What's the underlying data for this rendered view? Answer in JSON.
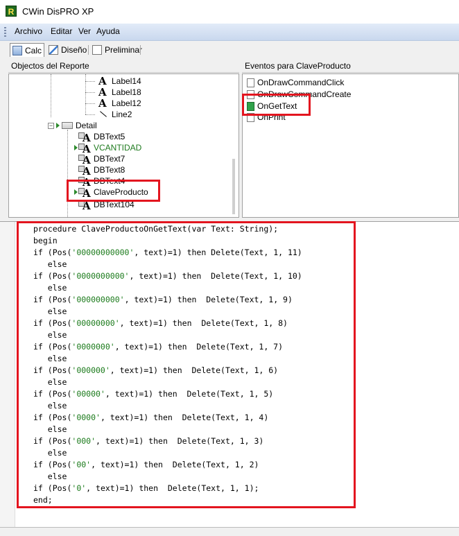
{
  "window": {
    "title": "CWin DisPRO XP",
    "icon_letter": "R"
  },
  "menu": [
    "Archivo",
    "Editar",
    "Ver",
    "Ayuda"
  ],
  "tabs": [
    {
      "label": "Calc",
      "active": true,
      "icon": "calculator-icon"
    },
    {
      "label": "Diseño",
      "active": false,
      "icon": "design-icon"
    },
    {
      "label": "Preliminar",
      "active": false,
      "icon": "preview-icon"
    }
  ],
  "objects_panel": {
    "header": "Objectos del Reporte",
    "nodes": {
      "label14": "Label14",
      "label18": "Label18",
      "label12": "Label12",
      "line2": "Line2",
      "detail": "Detail",
      "dbtext5": "DBText5",
      "vcantidad": "VCANTIDAD",
      "dbtext7": "DBText7",
      "dbtext8": "DBText8",
      "dbtext4": "DBText4",
      "claveproducto": "ClaveProducto",
      "dbtext104": "DBText104"
    }
  },
  "events_panel": {
    "header": "Eventos para ClaveProducto",
    "events": [
      "OnDrawCommandClick",
      "OnDrawCommandCreate",
      "OnGetText",
      "OnPrint"
    ],
    "selected": "OnGetText"
  },
  "code": [
    "procedure ClaveProductoOnGetText(var Text: String);",
    "begin",
    "if (Pos('00000000000', text)=1) then Delete(Text, 1, 11)",
    "   else",
    "if (Pos('0000000000', text)=1) then  Delete(Text, 1, 10)",
    "   else",
    "if (Pos('000000000', text)=1) then  Delete(Text, 1, 9)",
    "   else",
    "if (Pos('00000000', text)=1) then  Delete(Text, 1, 8)",
    "   else",
    "if (Pos('0000000', text)=1) then  Delete(Text, 1, 7)",
    "   else",
    "if (Pos('000000', text)=1) then  Delete(Text, 1, 6)",
    "   else",
    "if (Pos('00000', text)=1) then  Delete(Text, 1, 5)",
    "   else",
    "if (Pos('0000', text)=1) then  Delete(Text, 1, 4)",
    "   else",
    "if (Pos('000', text)=1) then  Delete(Text, 1, 3)",
    "   else",
    "if (Pos('00', text)=1) then  Delete(Text, 1, 2)",
    "   else",
    "if (Pos('0', text)=1) then  Delete(Text, 1, 1);",
    "end;"
  ],
  "colors": {
    "highlight_box": "#e3151f",
    "vcantidad_text": "#1e7a1e",
    "string_literal": "#1a7a1a"
  }
}
